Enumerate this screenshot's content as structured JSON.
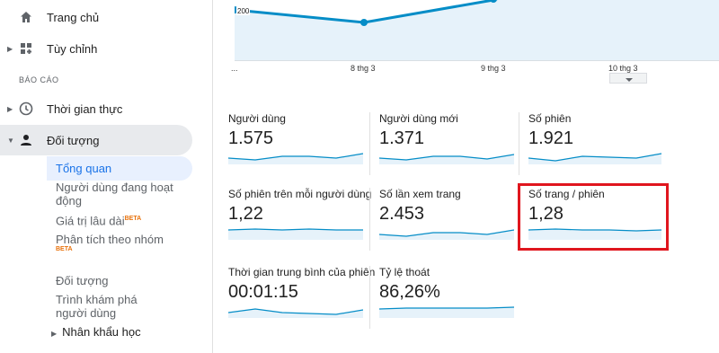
{
  "sidebar": {
    "home_label": "Trang chủ",
    "customize_label": "Tùy chỉnh",
    "section_label": "BÁO CÁO",
    "realtime_label": "Thời gian thực",
    "audience_label": "Đối tượng",
    "sub_items": {
      "overview": "Tổng quan",
      "active_users": "Người dùng đang hoạt động",
      "lifetime_value": "Giá trị lâu dài",
      "cohort": "Phân tích theo nhóm",
      "audiences": "Đối tượng",
      "user_explorer": "Trình khám phá người dùng",
      "demographics": "Nhân khẩu học"
    },
    "beta_label": "BETA"
  },
  "chart": {
    "y_label": "200",
    "x_labels": [
      "...",
      "8 thg 3",
      "9 thg 3",
      "10 thg 3"
    ],
    "line_color": "#058dc7"
  },
  "metrics": [
    {
      "label": "Người dùng",
      "value": "1.575"
    },
    {
      "label": "Người dùng mới",
      "value": "1.371"
    },
    {
      "label": "Số phiên",
      "value": "1.921"
    },
    {
      "label": "Số phiên trên mỗi người dùng",
      "value": "1,22"
    },
    {
      "label": "Số lần xem trang",
      "value": "2.453"
    },
    {
      "label": "Số trang / phiên",
      "value": "1,28"
    },
    {
      "label": "Thời gian trung bình của phiên",
      "value": "00:01:15"
    },
    {
      "label": "Tỷ lệ thoát",
      "value": "86,26%"
    }
  ],
  "highlight_color": "#e0161e"
}
